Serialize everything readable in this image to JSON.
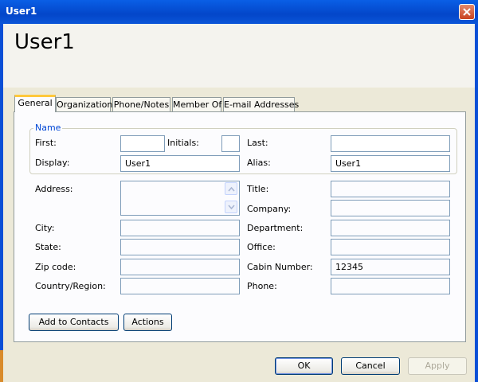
{
  "window": {
    "title": "User1"
  },
  "header": {
    "title": "User1"
  },
  "tabs": [
    {
      "label": "General",
      "active": true
    },
    {
      "label": "Organization",
      "active": false
    },
    {
      "label": "Phone/Notes",
      "active": false
    },
    {
      "label": "Member Of",
      "active": false
    },
    {
      "label": "E-mail Addresses",
      "active": false
    }
  ],
  "name_group": {
    "label": "Name",
    "first_label": "First:",
    "first_value": "",
    "initials_label": "Initials:",
    "initials_value": "",
    "last_label": "Last:",
    "last_value": "",
    "display_label": "Display:",
    "display_value": "User1",
    "alias_label": "Alias:",
    "alias_value": "User1"
  },
  "fields": {
    "address_label": "Address:",
    "address_value": "",
    "city_label": "City:",
    "city_value": "",
    "state_label": "State:",
    "state_value": "",
    "zip_label": "Zip code:",
    "zip_value": "",
    "country_label": "Country/Region:",
    "country_value": "",
    "title_label": "Title:",
    "title_value": "",
    "company_label": "Company:",
    "company_value": "",
    "department_label": "Department:",
    "department_value": "",
    "office_label": "Office:",
    "office_value": "",
    "cabin_label": "Cabin Number:",
    "cabin_value": "12345",
    "phone_label": "Phone:",
    "phone_value": ""
  },
  "actions": {
    "add_contacts": "Add to Contacts",
    "actions": "Actions"
  },
  "footer": {
    "ok": "OK",
    "cancel": "Cancel",
    "apply": "Apply"
  },
  "colors": {
    "titlebar": "#0346c9",
    "dialog_bg": "#ece9d8",
    "tab_highlight": "#ffc83c",
    "group_label": "#0046d5"
  }
}
